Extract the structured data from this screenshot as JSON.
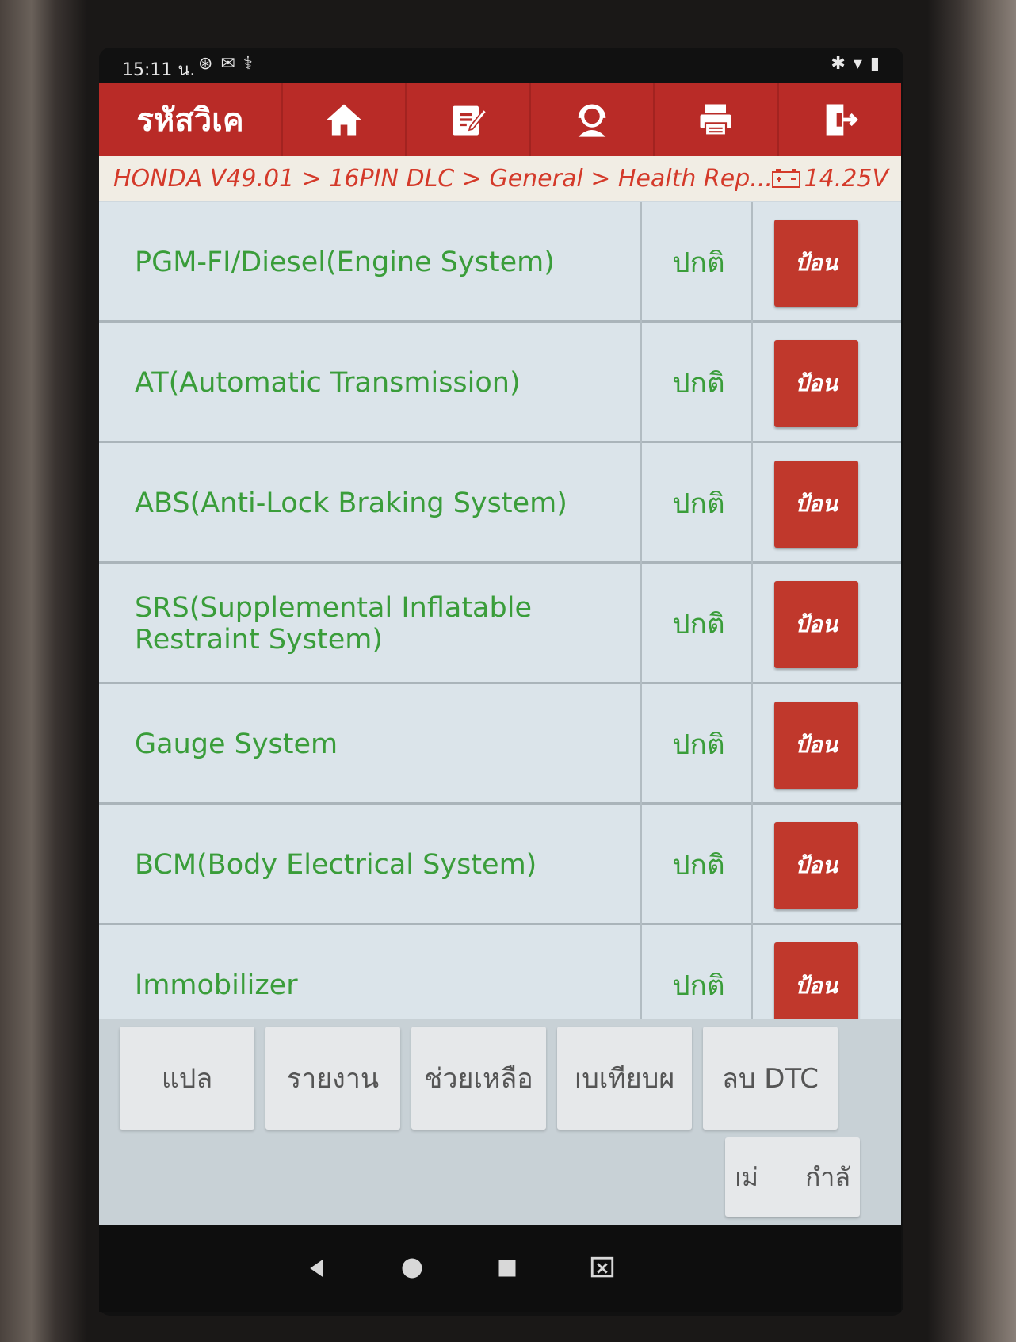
{
  "status_bar": {
    "time": "15:11 น.",
    "left_icons": [
      "bluetooth-circle-icon",
      "mail-icon",
      "stethoscope-icon"
    ],
    "right_icons": [
      "bluetooth-icon",
      "wifi-icon",
      "battery-icon"
    ]
  },
  "toolbar": {
    "title": "รหัสวิเค",
    "buttons": [
      "home-icon",
      "edit-icon",
      "support-agent-icon",
      "print-icon",
      "exit-icon"
    ]
  },
  "breadcrumb": {
    "path": "HONDA V49.01 > 16PIN DLC > General > Health Rep...",
    "voltage": "14.25V"
  },
  "systems": [
    {
      "name": "PGM-FI/Diesel(Engine System)",
      "status": "ปกติ",
      "action": "ป้อน"
    },
    {
      "name": "AT(Automatic Transmission)",
      "status": "ปกติ",
      "action": "ป้อน"
    },
    {
      "name": "ABS(Anti-Lock Braking System)",
      "status": "ปกติ",
      "action": "ป้อน"
    },
    {
      "name": "SRS(Supplemental Inflatable Restraint System)",
      "status": "ปกติ",
      "action": "ป้อน"
    },
    {
      "name": "Gauge System",
      "status": "ปกติ",
      "action": "ป้อน"
    },
    {
      "name": "BCM(Body Electrical System)",
      "status": "ปกติ",
      "action": "ป้อน"
    },
    {
      "name": "Immobilizer",
      "status": "ปกติ",
      "action": "ป้อน"
    }
  ],
  "bottom_buttons": [
    "แปล",
    "รายงาน",
    "ช่วยเหลือ",
    "ıบเทียบผ",
    "ลบ DTC"
  ],
  "bottom_button2": {
    "left": "ıม่",
    "right": "กำลั"
  },
  "colors": {
    "toolbar": "#b92b27",
    "text_green": "#3a9d3a",
    "button_red": "#c0382c",
    "crumb_red": "#d43a2a"
  }
}
